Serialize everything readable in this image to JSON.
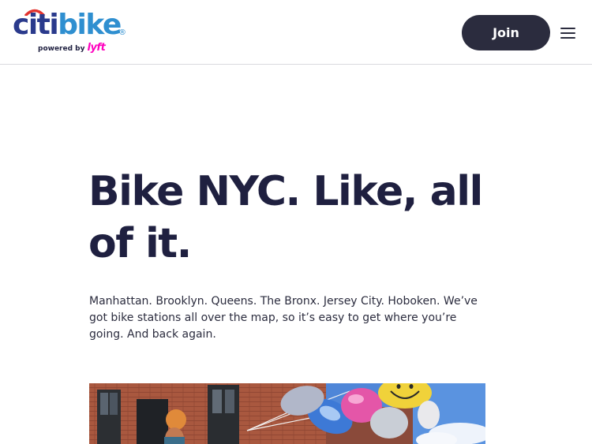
{
  "header": {
    "logo": {
      "citi": "citi",
      "bike": "bike",
      "registered": "®",
      "powered_by": "powered by",
      "lyft": "lyft"
    },
    "join_label": "Join",
    "menu_icon": "hamburger-menu-icon"
  },
  "hero": {
    "title": "Bike NYC. Like, all of it.",
    "body": "Manhattan. Brooklyn. Queens. The Bronx. Jersey City. Hoboken. We’ve got bike stations all over the map, so it’s easy to get where you’re going. And back again.",
    "image": "photo-person-with-balloons"
  },
  "colors": {
    "brand_navy": "#2a3a8c",
    "brand_blue": "#2f8fd0",
    "brand_red": "#e3342f",
    "lyft_pink": "#ff00bf",
    "button_dark": "#2b2c3e",
    "text_dark": "#1f2040"
  }
}
